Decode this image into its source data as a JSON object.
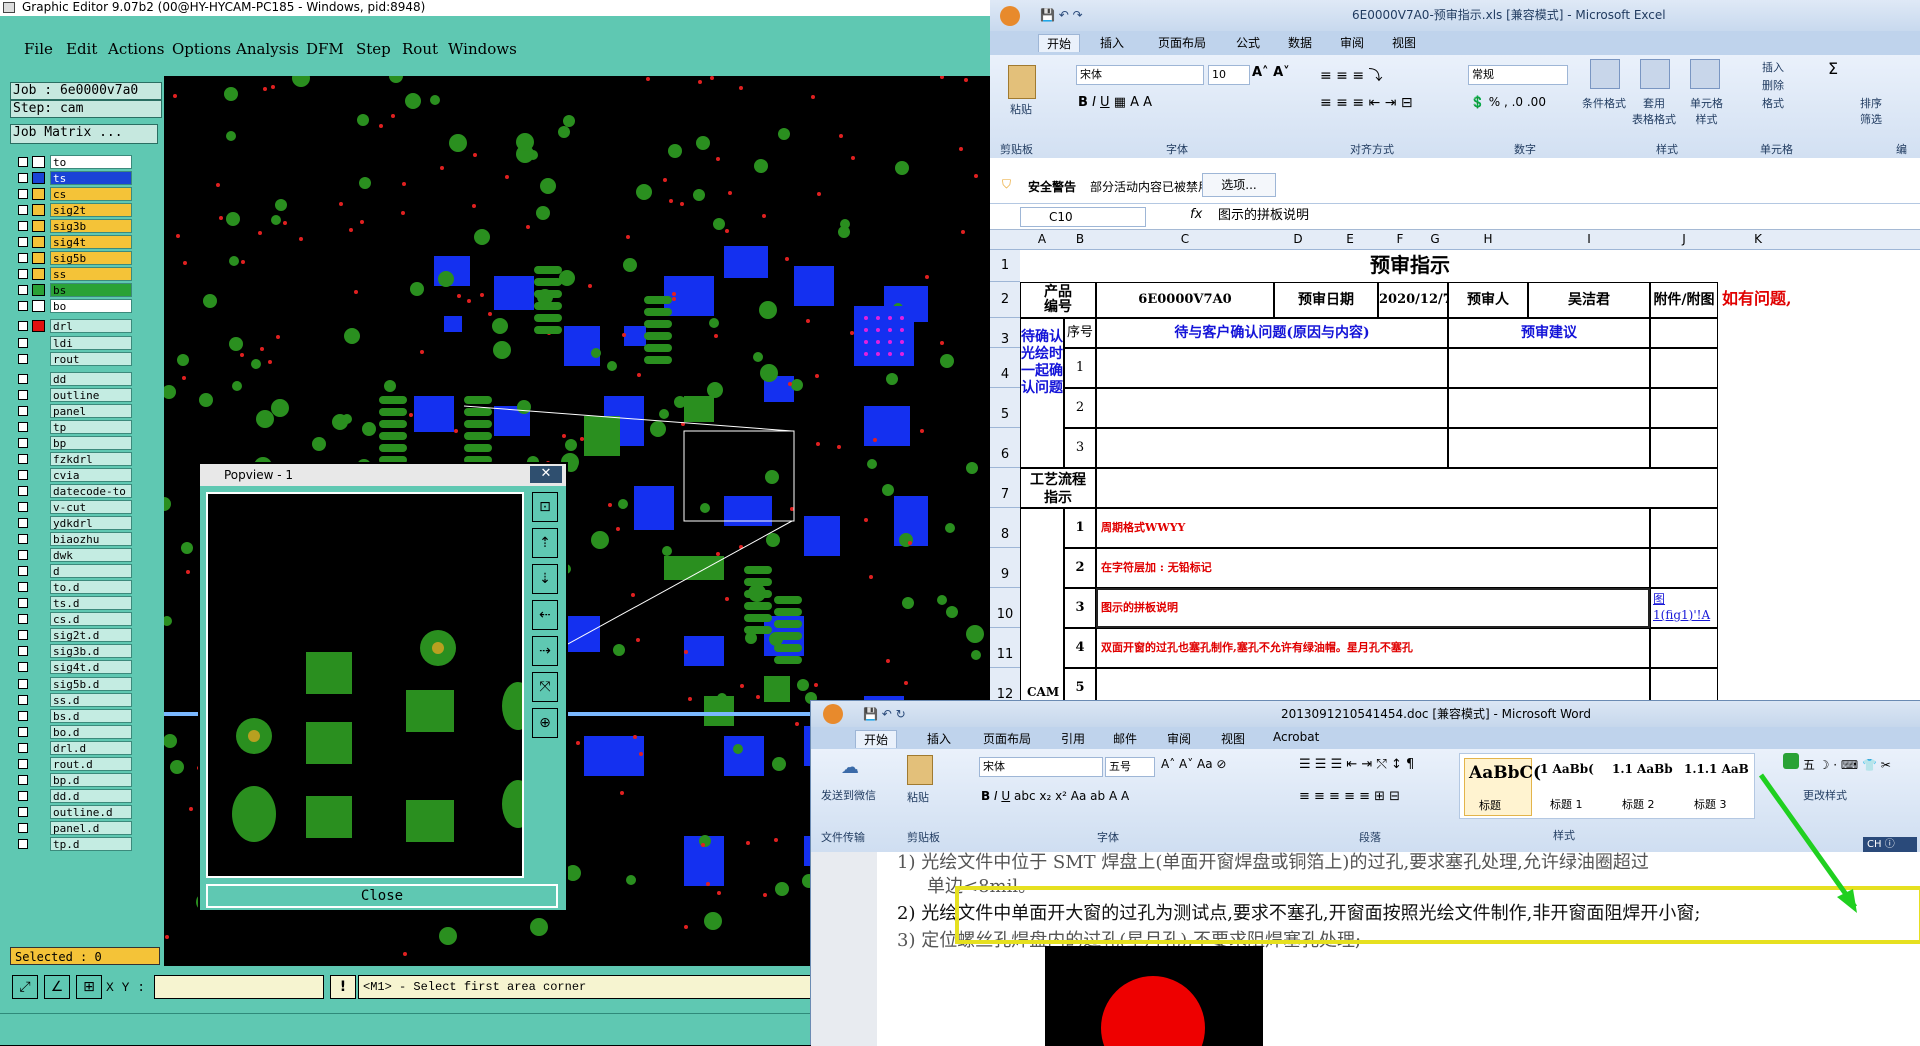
{
  "ge": {
    "title": "Graphic Editor 9.07b2 (00@HY-HYCAM-PC185 - Windows, pid:8948)",
    "menu": [
      "File",
      "Edit",
      "Actions",
      "Options",
      "Analysis",
      "DFM",
      "Step",
      "Rout",
      "Windows"
    ],
    "job": "Job : 6e0000v7a0",
    "step": "Step: cam",
    "job_matrix": "Job Matrix ...",
    "layers": [
      {
        "name": "to",
        "color": "#ffffff"
      },
      {
        "name": "ts",
        "color": "#1a43d6"
      },
      {
        "name": "cs",
        "color": "#f4c338"
      },
      {
        "name": "sig2t",
        "color": "#f4c338"
      },
      {
        "name": "sig3b",
        "color": "#f4c338"
      },
      {
        "name": "sig4t",
        "color": "#f4c338"
      },
      {
        "name": "sig5b",
        "color": "#f4c338"
      },
      {
        "name": "ss",
        "color": "#f4c338"
      },
      {
        "name": "bs",
        "color": "#2aa236"
      },
      {
        "name": "bo",
        "color": "#ffffff"
      },
      {
        "name": "drl",
        "color": "#e01010"
      },
      {
        "name": "ldi",
        "color": "#c4ece2"
      },
      {
        "name": "rout",
        "color": "#c4ece2"
      },
      {
        "name": "dd",
        "color": "#c4ece2"
      },
      {
        "name": "outline",
        "color": "#c4ece2"
      },
      {
        "name": "panel",
        "color": "#c4ece2"
      },
      {
        "name": "tp",
        "color": "#c4ece2"
      },
      {
        "name": "bp",
        "color": "#c4ece2"
      },
      {
        "name": "fzkdrl",
        "color": "#c4ece2"
      },
      {
        "name": "cvia",
        "color": "#c4ece2"
      },
      {
        "name": "datecode-to",
        "color": "#c4ece2"
      },
      {
        "name": "v-cut",
        "color": "#c4ece2"
      },
      {
        "name": "ydkdrl",
        "color": "#c4ece2"
      },
      {
        "name": "biaozhu",
        "color": "#c4ece2"
      },
      {
        "name": "dwk",
        "color": "#c4ece2"
      },
      {
        "name": "d",
        "color": "#c4ece2"
      },
      {
        "name": "to.d",
        "color": "#c4ece2"
      },
      {
        "name": "ts.d",
        "color": "#c4ece2"
      },
      {
        "name": "cs.d",
        "color": "#c4ece2"
      },
      {
        "name": "sig2t.d",
        "color": "#c4ece2"
      },
      {
        "name": "sig3b.d",
        "color": "#c4ece2"
      },
      {
        "name": "sig4t.d",
        "color": "#c4ece2"
      },
      {
        "name": "sig5b.d",
        "color": "#c4ece2"
      },
      {
        "name": "ss.d",
        "color": "#c4ece2"
      },
      {
        "name": "bs.d",
        "color": "#c4ece2"
      },
      {
        "name": "bo.d",
        "color": "#c4ece2"
      },
      {
        "name": "drl.d",
        "color": "#c4ece2"
      },
      {
        "name": "rout.d",
        "color": "#c4ece2"
      },
      {
        "name": "bp.d",
        "color": "#c4ece2"
      },
      {
        "name": "dd.d",
        "color": "#c4ece2"
      },
      {
        "name": "outline.d",
        "color": "#c4ece2"
      },
      {
        "name": "panel.d",
        "color": "#c4ece2"
      },
      {
        "name": "tp.d",
        "color": "#c4ece2"
      }
    ],
    "selected": "Selected : 0",
    "xy_label": "X Y :",
    "prompt": "<M1> - Select first area corner",
    "popview_title": "Popview - 1",
    "popview_close": "Close"
  },
  "xl": {
    "title": "6E0000V7A0-预审指示.xls [兼容模式] - Microsoft Excel",
    "tabs": [
      "开始",
      "插入",
      "页面布局",
      "公式",
      "数据",
      "审阅",
      "视图"
    ],
    "font": "宋体",
    "size": "10",
    "numfmt": "常规",
    "groups": [
      "剪贴板",
      "字体",
      "对齐方式",
      "数字",
      "样式",
      "单元格",
      "编"
    ],
    "btns": {
      "paste": "粘贴",
      "cond": "条件格式",
      "table": "套用\n表格格式",
      "cellstyle": "单元格\n样式",
      "insert": "插入",
      "delete": "删除",
      "format": "格式",
      "sort": "排序\n筛选"
    },
    "security": "安全警告",
    "security_msg": "部分活动内容已被禁用。",
    "options": "选项...",
    "namebox": "C10",
    "formula": "图示的拼板说明",
    "cols": [
      "A",
      "B",
      "C",
      "D",
      "E",
      "F",
      "G",
      "H",
      "I",
      "J",
      "K"
    ],
    "rows": [
      "1",
      "2",
      "3",
      "4",
      "5",
      "6",
      "7",
      "8",
      "9",
      "10",
      "11",
      "12"
    ],
    "sheet": {
      "title": "预审指示",
      "prod_no_label": "产品\n编号",
      "prod_no": "6E0000V7A0",
      "date_label": "预审日期",
      "date": "2020/12/7",
      "reviewer_label": "预审人",
      "reviewer": "吴洁君",
      "attach_label": "附件/附图",
      "note": "如有问题,",
      "seq": "序号",
      "confirm_head": "待与客户确认问题(原因与内容)",
      "suggest_head": "预审建议",
      "confirm_label": "待确认\n光绘时\n一起确\n认问题",
      "n1": "1",
      "n2": "2",
      "n3": "3",
      "n4": "4",
      "n5": "5",
      "flow_label": "工艺流程\n指示",
      "item1": "周期格式WWYY",
      "item2": "在字符层加 : 无铅标记",
      "item3": "图示的拼板说明",
      "item4": "双面开窗的过孔也塞孔制作,塞孔不允许有绿油帽。星月孔不塞孔",
      "link": "图\n1(fig1)'!A",
      "cam": "CAM"
    }
  },
  "wd": {
    "title": "2013091210541454.doc [兼容模式] - Microsoft Word",
    "tabs": [
      "开始",
      "插入",
      "页面布局",
      "引用",
      "邮件",
      "审阅",
      "视图",
      "Acrobat"
    ],
    "font": "宋体",
    "size": "五号",
    "groups": [
      "文件传输",
      "剪贴板",
      "字体",
      "段落",
      "样式"
    ],
    "send": "发送到微信",
    "paste": "粘贴",
    "styles": [
      {
        "sample": "AaBbC(",
        "name": "标题"
      },
      {
        "sample": "1 AaBb(",
        "name": "标题 1"
      },
      {
        "sample": "1.1 AaBb",
        "name": "标题 2"
      },
      {
        "sample": "1.1.1 AaB",
        "name": "标题 3"
      }
    ],
    "change_style": "更改样式",
    "ime": "五",
    "ch": "CH",
    "line1": "1)  光绘文件中位于 SMT 焊盘上(单面开窗焊盘或铜箔上)的过孔,要求塞孔处理,允许绿油圈超过",
    "line1b": "单边<8mil。",
    "line2": "2)  光绘文件中单面开大窗的过孔为测试点,要求不塞孔,开窗面按照光绘文件制作,非开窗面阻焊开小窗;",
    "line3": "3)  定位螺丝孔焊盘内的过孔(星月孔),不要求阻焊塞孔处理;"
  },
  "colors": {
    "ge_bg": "#5fc8b2",
    "copper": "#2a8f1f",
    "blue": "#1430f0",
    "highlight": "#e6e020",
    "red": "#e00000"
  }
}
